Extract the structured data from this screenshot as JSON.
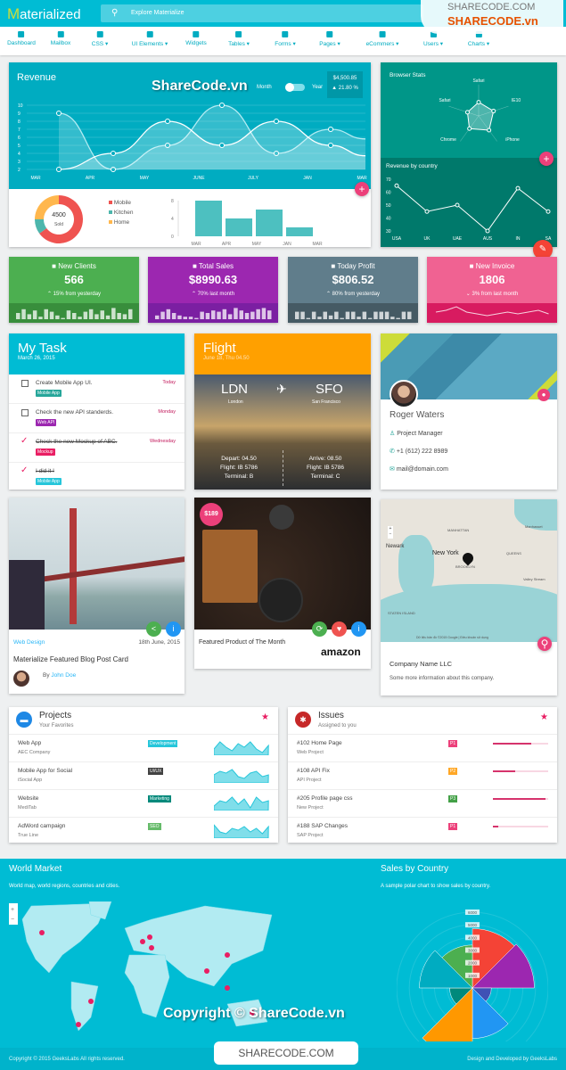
{
  "header": {
    "logo_initial": "M",
    "logo_rest": "aterialized",
    "search_placeholder": "Explore Materialize"
  },
  "nav": [
    {
      "label": "Dashboard",
      "icon": "dashboard-icon"
    },
    {
      "label": "Mailbox",
      "icon": "mail-icon"
    },
    {
      "label": "CSS",
      "icon": "invert-colors-icon",
      "dropdown": true
    },
    {
      "label": "UI Elements",
      "icon": "palette-icon",
      "dropdown": true
    },
    {
      "label": "Widgets",
      "icon": "widgets-icon"
    },
    {
      "label": "Tables",
      "icon": "table-icon",
      "dropdown": true
    },
    {
      "label": "Forms",
      "icon": "form-icon",
      "dropdown": true
    },
    {
      "label": "Pages",
      "icon": "pages-icon",
      "dropdown": true
    },
    {
      "label": "eCommers",
      "icon": "cart-icon",
      "dropdown": true
    },
    {
      "label": "Users",
      "icon": "user-icon",
      "dropdown": true
    },
    {
      "label": "Charts",
      "icon": "chart-icon",
      "dropdown": true
    }
  ],
  "revenue": {
    "title": "Revenue",
    "toggle_left": "Month",
    "toggle_right": "Year",
    "amount": "$4,500.85",
    "change": "21.80 %",
    "chart_data": {
      "type": "line",
      "categories": [
        "MAR",
        "APR",
        "MAY",
        "JUNE",
        "JULY",
        "JAN",
        "MAR"
      ],
      "ylim": [
        2,
        10
      ],
      "yticks": [
        10,
        9,
        8,
        7,
        6,
        5,
        4,
        3,
        2
      ],
      "series": [
        {
          "values": [
            9,
            2,
            5,
            10,
            4,
            7,
            5.8
          ]
        },
        {
          "values": [
            2,
            4,
            8,
            5,
            8,
            5,
            3.7
          ]
        }
      ]
    },
    "donut": {
      "center_value": "4500",
      "center_label": "Sold",
      "legend": [
        {
          "label": "Mobile",
          "value": 65,
          "color": "#ef5350"
        },
        {
          "label": "Kitchen",
          "value": 10,
          "color": "#4db6ac"
        },
        {
          "label": "Home",
          "value": 25,
          "color": "#ffb74d"
        }
      ]
    },
    "bars": {
      "type": "bar",
      "categories": [
        "MAR",
        "APR",
        "MAY",
        "JAN",
        "MAR"
      ],
      "values": [
        8,
        4,
        6,
        2,
        0,
        5.3
      ],
      "yticks": [
        8,
        4,
        0
      ],
      "ylim": [
        0,
        8
      ]
    }
  },
  "browser_stats": {
    "title": "Browser Stats",
    "radar_labels": [
      "Safari",
      "IE10",
      "iPhone",
      "Chrome",
      "Safari"
    ],
    "radar_values": [
      0.7,
      0.8,
      0.9,
      0.8,
      0.6
    ]
  },
  "revenue_by_country": {
    "title": "Revenue by country",
    "chart_data": {
      "type": "line",
      "categories": [
        "USA",
        "UK",
        "UAE",
        "AUS",
        "IN",
        "SA"
      ],
      "values": [
        65,
        45,
        50,
        30,
        63,
        45
      ],
      "ylim": [
        30,
        70
      ],
      "yticks": [
        70,
        60,
        50,
        40,
        30
      ]
    }
  },
  "stats": [
    {
      "title": "New Clients",
      "icon": "people-icon",
      "value": "566",
      "sub": "15% from yesterday",
      "trend": "up",
      "color": "#4caf50",
      "dark": "#388e3c",
      "bars": [
        5,
        8,
        4,
        7,
        2,
        8,
        6,
        3,
        1,
        7,
        5,
        2,
        6,
        8,
        4,
        7,
        3,
        9,
        5,
        4,
        8
      ]
    },
    {
      "title": "Total Sales",
      "icon": "dollar-icon",
      "value": "$8990.63",
      "sub": "70% last month",
      "trend": "up",
      "color": "#9c27b0",
      "dark": "#7b1fa2",
      "bars": [
        3,
        6,
        8,
        5,
        3,
        2,
        2,
        1,
        6,
        5,
        7,
        6,
        8,
        4,
        9,
        7,
        5,
        6,
        8,
        9,
        7
      ]
    },
    {
      "title": "Today Profit",
      "icon": "trending-up-icon",
      "value": "$806.52",
      "sub": "80% from yesterday",
      "trend": "up",
      "color": "#607d8b",
      "dark": "#455a64",
      "bars": [
        6,
        6,
        1,
        6,
        2,
        6,
        3,
        6,
        1,
        6,
        6,
        2,
        6,
        1,
        6,
        6,
        6,
        2,
        1,
        6,
        6
      ]
    },
    {
      "title": "New Invoice",
      "icon": "file-icon",
      "value": "1806",
      "sub": "3% from last month",
      "trend": "down",
      "color": "#f06292",
      "dark": "#d81b60",
      "line": [
        5,
        6,
        8,
        5,
        4,
        3,
        4,
        5,
        4,
        5,
        6,
        4
      ]
    }
  ],
  "task": {
    "title": "My Task",
    "date": "March 26, 2015",
    "items": [
      {
        "text": "Create Mobile App UI.",
        "day": "Today",
        "tag": "Mobile App",
        "tag_color": "#26a69a",
        "done": false
      },
      {
        "text": "Check the new API standerds.",
        "day": "Monday",
        "tag": "Web API",
        "tag_color": "#9c27b0",
        "done": false
      },
      {
        "text": "Check the new Mockup of ABC.",
        "day": "Wednesday",
        "tag": "Mockup",
        "tag_color": "#e91e63",
        "done": true
      },
      {
        "text": "I did it !",
        "day": "",
        "tag": "Mobile App",
        "tag_color": "#26c6da",
        "done": true
      }
    ]
  },
  "flight": {
    "title": "Flight",
    "date": "June 18, Thu 04.50",
    "from": "LDN",
    "from_city": "London",
    "to": "SFO",
    "to_city": "San Francisco",
    "depart": [
      "Depart: 04.50",
      "Flight: IB 5786",
      "Terminal: B"
    ],
    "arrive": [
      "Arrive: 08.50",
      "Flight: IB 5786",
      "Terminal: C"
    ]
  },
  "profile": {
    "name": "Roger Waters",
    "role": "Project Manager",
    "phone": "+1 (612) 222 8989",
    "email": "mail@domain.com"
  },
  "blog": {
    "category": "Web Design",
    "date": "18th June, 2015",
    "title": "Materialize Featured Blog Post Card",
    "by": "By",
    "author": "John Doe"
  },
  "product": {
    "price": "$189",
    "title": "Featured Product of The Month",
    "brand": "amazon"
  },
  "map": {
    "company": "Company Name LLC",
    "info": "Some more information about this company.",
    "labels": [
      "Newark",
      "New York",
      "BROOKLYN",
      "MANHATTAN",
      "QUEENS",
      "Valley Stream",
      "STATEN ISLAND",
      "Manhasset"
    ],
    "attribution": "Dữ liệu bản đồ ©2015 Google | Điều khoản sử dụng"
  },
  "projects": {
    "title": "Projects",
    "subtitle": "Your Favorites",
    "items": [
      {
        "name": "Web App",
        "company": "AEC Company",
        "tag": "Development",
        "tag_color": "#26c6da",
        "spark": [
          3,
          7,
          4,
          2,
          6,
          4,
          7,
          3,
          1,
          5
        ]
      },
      {
        "name": "Mobile App for Social",
        "company": "iSocial App",
        "tag": "UI/UX",
        "tag_color": "#424242",
        "spark": [
          4,
          6,
          5,
          7,
          3,
          2,
          5,
          6,
          3,
          4
        ]
      },
      {
        "name": "Website",
        "company": "MediTab",
        "tag": "Marketing",
        "tag_color": "#00897b",
        "spark": [
          2,
          5,
          4,
          7,
          3,
          6,
          1,
          7,
          4,
          5
        ]
      },
      {
        "name": "AdWord campaign",
        "company": "True Line",
        "tag": "SEO",
        "tag_color": "#66bb6a",
        "spark": [
          7,
          3,
          2,
          5,
          4,
          6,
          3,
          5,
          2,
          6
        ]
      }
    ]
  },
  "issues": {
    "title": "Issues",
    "subtitle": "Assigned to you",
    "items": [
      {
        "name": "#102 Home Page",
        "project": "Web Project",
        "priority": "P1",
        "color": "#ec407a",
        "progress": 0.7
      },
      {
        "name": "#108 API Fix",
        "project": "API Project",
        "priority": "P2",
        "color": "#ffa726",
        "progress": 0.4
      },
      {
        "name": "#205 Profile page css",
        "project": "New Project",
        "priority": "P3",
        "color": "#43a047",
        "progress": 0.95
      },
      {
        "name": "#188 SAP Changes",
        "project": "SAP Project",
        "priority": "P1",
        "color": "#ec407a",
        "progress": 0.1
      }
    ]
  },
  "world": {
    "title": "World Market",
    "subtitle": "World map, world regions, countries and cities."
  },
  "sales_country": {
    "title": "Sales by Country",
    "subtitle": "A sample polar chart to show sales by country.",
    "chart_data": {
      "type": "polar",
      "ticks": [
        "1000",
        "2000",
        "3000",
        "4000",
        "5000",
        "6000"
      ],
      "rmax": 6000,
      "values": [
        4700,
        4900,
        1500,
        4000,
        5600,
        1800,
        4200,
        3400
      ],
      "colors": [
        "#f44336",
        "#9c27b0",
        "#3f51b5",
        "#2196f3",
        "#ff9800",
        "#00897b",
        "#00acc1",
        "#4caf50"
      ]
    }
  },
  "footer": {
    "left": "Copyright © 2015 GeeksLabs All rights reserved.",
    "right": "Design and Developed by GeeksLabs"
  },
  "watermark": {
    "top": "SHARECODE.COM",
    "top2": "SHARECODE.vn",
    "mid": "ShareCode.vn",
    "bottom": "Copyright © ShareCode.vn",
    "badge": "SHARECODE.COM"
  }
}
